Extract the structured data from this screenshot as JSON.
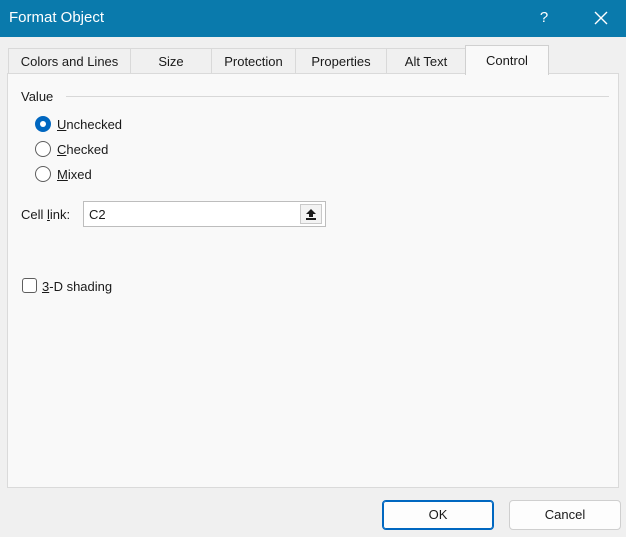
{
  "window": {
    "title": "Format Object",
    "help_label": "?",
    "accent_color": "#0a7aac"
  },
  "tabs": [
    {
      "label": "Colors and Lines",
      "active": false
    },
    {
      "label": "Size",
      "active": false
    },
    {
      "label": "Protection",
      "active": false
    },
    {
      "label": "Properties",
      "active": false
    },
    {
      "label": "Alt Text",
      "active": false
    },
    {
      "label": "Control",
      "active": true
    }
  ],
  "value_group": {
    "label": "Value",
    "options": [
      {
        "key": "U",
        "rest": "nchecked",
        "checked": true
      },
      {
        "key": "C",
        "rest": "hecked",
        "checked": false
      },
      {
        "key": "M",
        "rest": "ixed",
        "checked": false
      }
    ]
  },
  "cell_link": {
    "label_pre": "Cell ",
    "label_key": "l",
    "label_post": "ink:",
    "value": "C2",
    "collapse_icon": "collapse-dialog-icon"
  },
  "shading": {
    "label_key": "3",
    "label_rest": "-D shading",
    "checked": false
  },
  "buttons": {
    "ok": "OK",
    "cancel": "Cancel"
  }
}
